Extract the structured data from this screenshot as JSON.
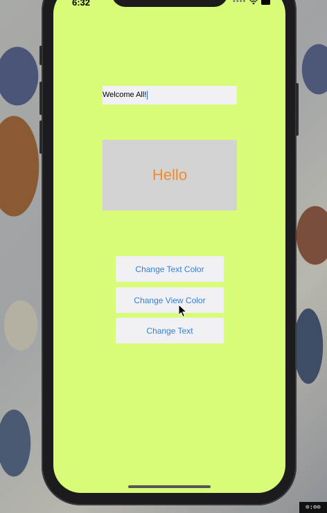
{
  "status_bar": {
    "time": "6:32",
    "signal_dots": "••••",
    "wifi_icon": "wifi-icon",
    "battery_icon": "battery-icon"
  },
  "text_field": {
    "value": "Welcome All!"
  },
  "label_view": {
    "text": "Hello",
    "text_color": "#f08b28",
    "background": "#d3d3d3"
  },
  "buttons": [
    {
      "label": "Change Text Color"
    },
    {
      "label": "Change View Color"
    },
    {
      "label": "Change Text"
    }
  ],
  "colors": {
    "screen_background": "#d8fb78",
    "button_text": "#2f7fdc",
    "button_background": "#f1f1f5"
  },
  "recorder_badge": {
    "text": "⊙:⊙⊙"
  }
}
